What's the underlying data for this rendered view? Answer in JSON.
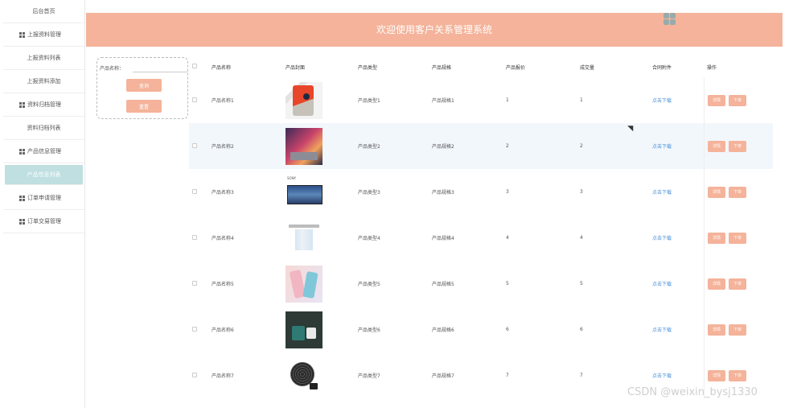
{
  "sidebar": {
    "items": [
      {
        "label": "后台首页",
        "group": false
      },
      {
        "label": "上报资料管理",
        "group": true
      },
      {
        "label": "上报资料列表",
        "group": false
      },
      {
        "label": "上报资料添加",
        "group": false
      },
      {
        "label": "资料归档管理",
        "group": true
      },
      {
        "label": "资料归档列表",
        "group": false
      },
      {
        "label": "产品信息管理",
        "group": true
      },
      {
        "label": "产品信息列表",
        "group": false,
        "active": true
      },
      {
        "label": "订单申请管理",
        "group": true
      },
      {
        "label": "订单交易管理",
        "group": true
      }
    ]
  },
  "header": {
    "title": "欢迎使用客户关系管理系统"
  },
  "search": {
    "label": "产品名称：",
    "input_value": "",
    "query_label": "查询",
    "reset_label": "重置"
  },
  "table": {
    "columns": [
      "产品名称",
      "产品封面",
      "产品类型",
      "产品规格",
      "产品报价",
      "成交量",
      "合同附件",
      "操作"
    ],
    "rows": [
      {
        "name": "产品名称1",
        "type": "产品类型1",
        "spec": "产品规格1",
        "price": "1",
        "deal": "1",
        "file": "点击下载",
        "image": "phone-product-image"
      },
      {
        "name": "产品名称2",
        "type": "产品类型2",
        "spec": "产品规格2",
        "price": "2",
        "deal": "2",
        "file": "点击下载",
        "image": "laptop-product-image"
      },
      {
        "name": "产品名称3",
        "type": "产品类型3",
        "spec": "产品规格3",
        "price": "3",
        "deal": "3",
        "file": "点击下载",
        "image": "tv-product-image"
      },
      {
        "name": "产品名称4",
        "type": "产品类型4",
        "spec": "产品规格4",
        "price": "4",
        "deal": "4",
        "file": "点击下载",
        "image": "drying-rack-product-image"
      },
      {
        "name": "产品名称5",
        "type": "产品类型5",
        "spec": "产品规格5",
        "price": "5",
        "deal": "5",
        "file": "点击下载",
        "image": "phone-case-product-image"
      },
      {
        "name": "产品名称6",
        "type": "产品类型6",
        "spec": "产品规格6",
        "price": "6",
        "deal": "6",
        "file": "点击下载",
        "image": "mug-product-image"
      },
      {
        "name": "产品名称7",
        "type": "产品类型7",
        "spec": "产品规格7",
        "price": "7",
        "deal": "7",
        "file": "点击下载",
        "image": "fan-product-image"
      }
    ],
    "detail_label": "详情",
    "delete_label": "下单"
  },
  "watermark": "CSDN @weixin_bysj1330",
  "colors": {
    "accent": "#f4b39a",
    "active_sidebar": "#bfdfe0",
    "link": "#4a90d9",
    "row_highlight": "#f2f7fc"
  }
}
